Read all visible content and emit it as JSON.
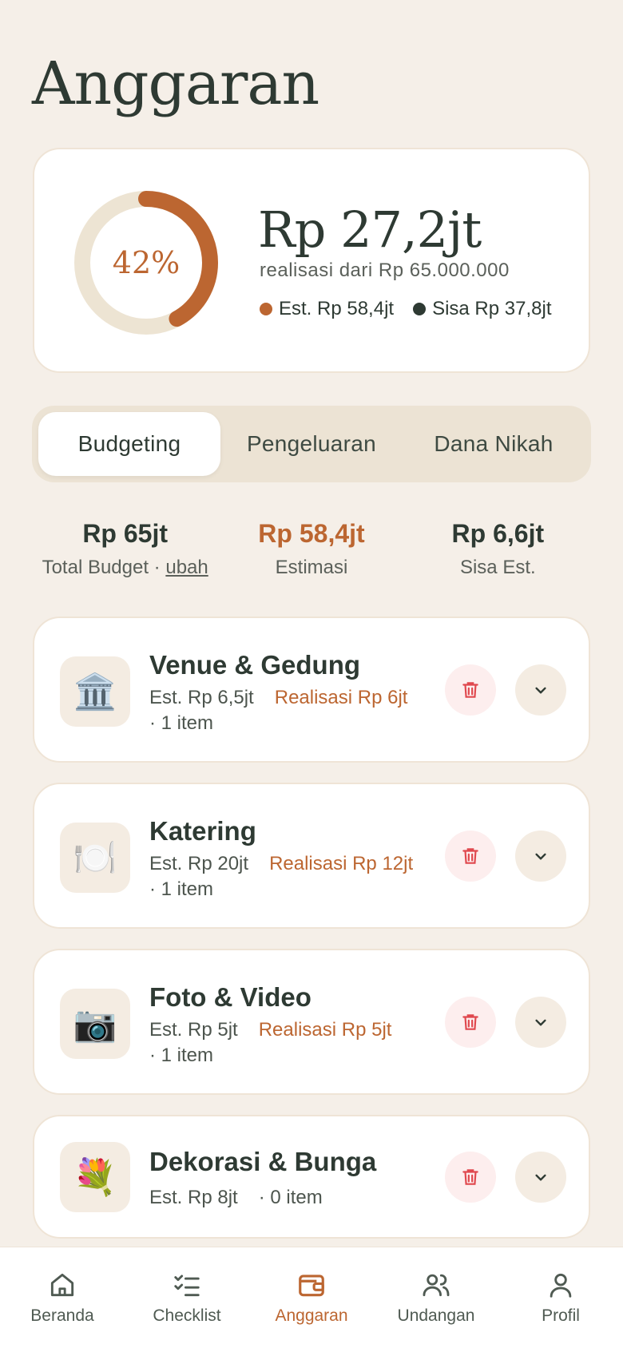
{
  "page": {
    "title": "Anggaran"
  },
  "summary": {
    "percent_label": "42%",
    "percent": 42,
    "realized_amount": "Rp 27,2jt",
    "realized_caption": "realisasi dari Rp 65.000.000",
    "legend": [
      {
        "label": "Est. Rp 58,4jt",
        "color": "#bc6631"
      },
      {
        "label": "Sisa Rp 37,8jt",
        "color": "#2e3a33"
      }
    ]
  },
  "tabs": [
    {
      "label": "Budgeting",
      "active": true
    },
    {
      "label": "Pengeluaran",
      "active": false
    },
    {
      "label": "Dana Nikah",
      "active": false
    }
  ],
  "stats": {
    "total": {
      "value": "Rp 65jt",
      "label": "Total Budget · ",
      "link": "ubah"
    },
    "estimate": {
      "value": "Rp 58,4jt",
      "label": "Estimasi"
    },
    "remaining": {
      "value": "Rp 6,6jt",
      "label": "Sisa Est."
    }
  },
  "categories": [
    {
      "icon": "🏛️",
      "icon_name": "bank-icon",
      "name": "Venue & Gedung",
      "estimate": "Est. Rp 6,5jt",
      "realized": "Realisasi Rp 6jt",
      "items": "· 1 item"
    },
    {
      "icon": "🍽️",
      "icon_name": "plate-icon",
      "name": "Katering",
      "estimate": "Est. Rp 20jt",
      "realized": "Realisasi Rp 12jt",
      "items": "· 1 item"
    },
    {
      "icon": "📷",
      "icon_name": "camera-icon",
      "name": "Foto & Video",
      "estimate": "Est. Rp 5jt",
      "realized": "Realisasi Rp 5jt",
      "items": "· 1 item"
    },
    {
      "icon": "💐",
      "icon_name": "bouquet-icon",
      "name": "Dekorasi & Bunga",
      "estimate": "Est. Rp 8jt",
      "realized": "",
      "items": "· 0 item"
    }
  ],
  "nav": [
    {
      "label": "Beranda",
      "icon": "home-icon",
      "active": false
    },
    {
      "label": "Checklist",
      "icon": "checklist-icon",
      "active": false
    },
    {
      "label": "Anggaran",
      "icon": "wallet-icon",
      "active": true
    },
    {
      "label": "Undangan",
      "icon": "users-icon",
      "active": false
    },
    {
      "label": "Profil",
      "icon": "user-icon",
      "active": false
    }
  ],
  "colors": {
    "accent": "#bc6631",
    "dark": "#2e3a33",
    "track": "#ede4d3",
    "danger": "#e0484e"
  }
}
